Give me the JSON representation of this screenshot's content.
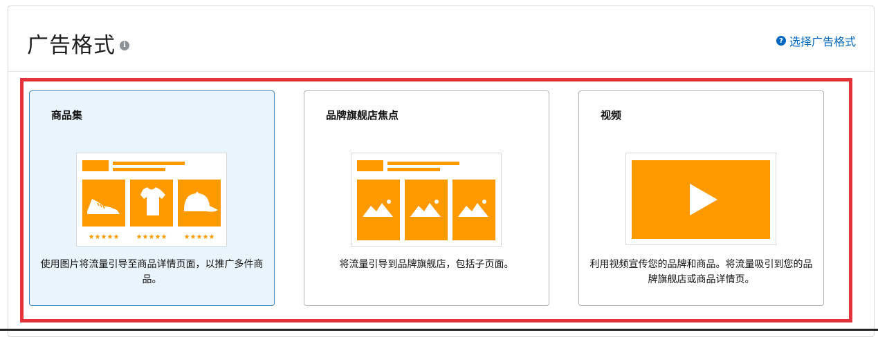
{
  "header": {
    "title": "广告格式",
    "info_icon": "info-icon",
    "help_link_label": "选择广告格式",
    "help_icon": "question-icon"
  },
  "colors": {
    "accent_orange": "#ff9900",
    "selection_red": "#e5333b",
    "link_blue": "#0066c0",
    "selected_bg": "#eaf4fc"
  },
  "cards": [
    {
      "title": "商品集",
      "description": "使用图片将流量引导至商品详情页面，以推广多件商品。",
      "selected": true,
      "icons": [
        "shoe-icon",
        "tshirt-icon",
        "cap-icon"
      ],
      "ratings": [
        "★★★★★",
        "★★★★★",
        "★★★★★"
      ]
    },
    {
      "title": "品牌旗舰店焦点",
      "description": "将流量引导到品牌旗舰店，包括子页面。",
      "selected": false,
      "icons": [
        "landscape-icon",
        "landscape-icon",
        "landscape-icon"
      ]
    },
    {
      "title": "视频",
      "description": "利用视频宣传您的品牌和商品。将流量吸引到您的品牌旗舰店或商品详情页。",
      "selected": false,
      "icons": [
        "play-icon"
      ]
    }
  ]
}
